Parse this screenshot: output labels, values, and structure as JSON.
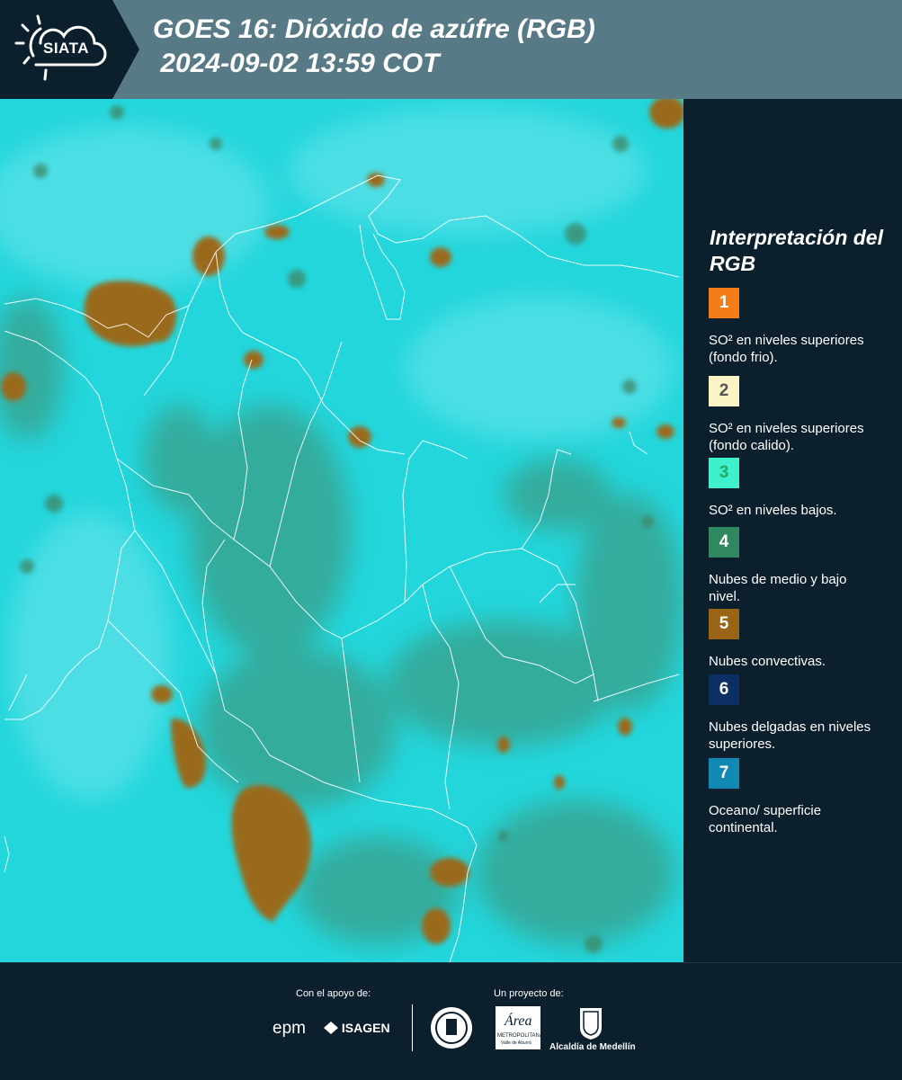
{
  "header": {
    "logo_text": "SIATA",
    "title_line1": "GOES 16: Dióxido de azúfre (RGB)",
    "title_line2": " 2024-09-02 13:59 COT"
  },
  "legend": {
    "title": "Interpretación del RGB",
    "items": [
      {
        "number": "1",
        "label": "SO² en niveles superiores (fondo frio).",
        "color": "#f57d17"
      },
      {
        "number": "2",
        "label": "SO² en niveles superiores (fondo calido).",
        "color": "#fdf4c6"
      },
      {
        "number": "3",
        "label": "SO² en niveles bajos.",
        "color": "#3ff0cc"
      },
      {
        "number": "4",
        "label": "Nubes de medio y bajo nivel.",
        "color": "#2f8860"
      },
      {
        "number": "5",
        "label": "Nubes convectivas.",
        "color": "#9a6416"
      },
      {
        "number": "6",
        "label": "Nubes delgadas en niveles superiores.",
        "color": "#0b2f62"
      },
      {
        "number": "7",
        "label": "Oceano/ superficie continental.",
        "color": "#1288b5"
      }
    ]
  },
  "footer": {
    "support_label": "Con el apoyo de:",
    "project_label": "Un proyecto de:",
    "epm": "epm",
    "isagen": "ISAGEN",
    "area_top": "Área",
    "area_sub": "METROPOLITANA",
    "area_sub2": "Valle de Aburrá",
    "alcaldia": "Alcaldía de Medellín"
  },
  "colors": {
    "map_background": "#22d6dc",
    "cloud_convective": "#9a6a1c",
    "cloud_mid": "#3a9e88",
    "border": "#ffffff"
  }
}
